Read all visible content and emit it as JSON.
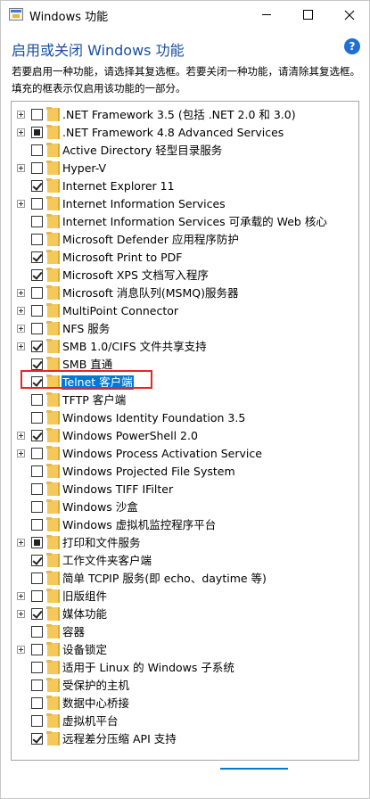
{
  "window": {
    "title": "Windows 功能"
  },
  "header": {
    "heading": "启用或关闭 Windows 功能",
    "help": "?",
    "description": "若要启用一种功能，请选择其复选框。若要关闭一种功能，请清除其复选框。填充的框表示仅启用该功能的一部分。"
  },
  "features": [
    {
      "label": ".NET Framework 3.5 (包括 .NET 2.0 和 3.0)",
      "state": "unchecked",
      "expandable": true
    },
    {
      "label": ".NET Framework 4.8 Advanced Services",
      "state": "partial",
      "expandable": true
    },
    {
      "label": "Active Directory 轻型目录服务",
      "state": "unchecked",
      "expandable": false
    },
    {
      "label": "Hyper-V",
      "state": "unchecked",
      "expandable": true
    },
    {
      "label": "Internet Explorer 11",
      "state": "checked",
      "expandable": false
    },
    {
      "label": "Internet Information Services",
      "state": "unchecked",
      "expandable": true
    },
    {
      "label": "Internet Information Services 可承载的 Web 核心",
      "state": "unchecked",
      "expandable": false
    },
    {
      "label": "Microsoft Defender 应用程序防护",
      "state": "unchecked",
      "expandable": false
    },
    {
      "label": "Microsoft Print to PDF",
      "state": "checked",
      "expandable": false
    },
    {
      "label": "Microsoft XPS 文档写入程序",
      "state": "checked",
      "expandable": false
    },
    {
      "label": "Microsoft 消息队列(MSMQ)服务器",
      "state": "unchecked",
      "expandable": true
    },
    {
      "label": "MultiPoint Connector",
      "state": "unchecked",
      "expandable": true
    },
    {
      "label": "NFS 服务",
      "state": "unchecked",
      "expandable": true
    },
    {
      "label": "SMB 1.0/CIFS 文件共享支持",
      "state": "checked",
      "expandable": true
    },
    {
      "label": "SMB 直通",
      "state": "checked",
      "expandable": false
    },
    {
      "label": "Telnet 客户端",
      "state": "checked",
      "expandable": false,
      "selected": true
    },
    {
      "label": "TFTP 客户端",
      "state": "unchecked",
      "expandable": false
    },
    {
      "label": "Windows Identity Foundation 3.5",
      "state": "unchecked",
      "expandable": false
    },
    {
      "label": "Windows PowerShell 2.0",
      "state": "checked",
      "expandable": true
    },
    {
      "label": "Windows Process Activation Service",
      "state": "unchecked",
      "expandable": true
    },
    {
      "label": "Windows Projected File System",
      "state": "unchecked",
      "expandable": false
    },
    {
      "label": "Windows TIFF IFilter",
      "state": "unchecked",
      "expandable": false
    },
    {
      "label": "Windows 沙盒",
      "state": "unchecked",
      "expandable": false
    },
    {
      "label": "Windows 虚拟机监控程序平台",
      "state": "unchecked",
      "expandable": false
    },
    {
      "label": "打印和文件服务",
      "state": "partial",
      "expandable": true
    },
    {
      "label": "工作文件夹客户端",
      "state": "checked",
      "expandable": false
    },
    {
      "label": "简单 TCPIP 服务(即 echo、daytime 等)",
      "state": "unchecked",
      "expandable": false
    },
    {
      "label": "旧版组件",
      "state": "unchecked",
      "expandable": true
    },
    {
      "label": "媒体功能",
      "state": "checked",
      "expandable": true
    },
    {
      "label": "容器",
      "state": "unchecked",
      "expandable": false
    },
    {
      "label": "设备锁定",
      "state": "unchecked",
      "expandable": true
    },
    {
      "label": "适用于 Linux 的 Windows 子系统",
      "state": "unchecked",
      "expandable": false
    },
    {
      "label": "受保护的主机",
      "state": "unchecked",
      "expandable": false
    },
    {
      "label": "数据中心桥接",
      "state": "unchecked",
      "expandable": false
    },
    {
      "label": "虚拟机平台",
      "state": "unchecked",
      "expandable": false
    },
    {
      "label": "远程差分压缩 API 支持",
      "state": "checked",
      "expandable": false
    }
  ]
}
